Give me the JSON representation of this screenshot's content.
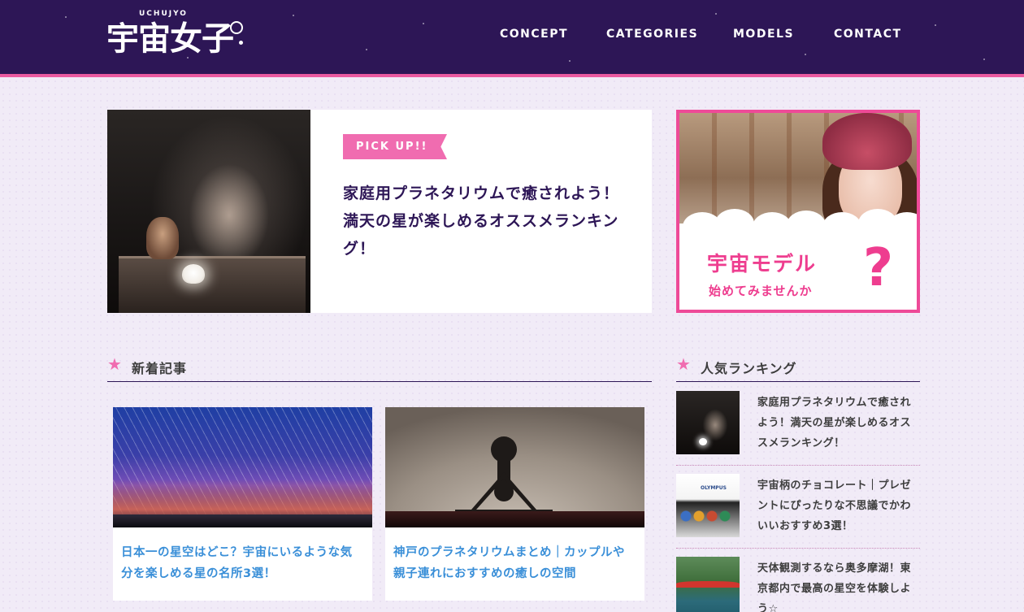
{
  "header": {
    "logo_small": "UCHUJYO",
    "logo_main": "宇宙女子",
    "nav": [
      {
        "label": "CONCEPT"
      },
      {
        "label": "CATEGORIES"
      },
      {
        "label": "MODELS"
      },
      {
        "label": "CONTACT"
      }
    ]
  },
  "pickup": {
    "badge": "PICK UP!!",
    "title": "家庭用プラネタリウムで癒されよう！満天の星が楽しめるオススメランキング！"
  },
  "model_banner": {
    "title": "宇宙モデル",
    "subtitle": "始めてみませんか",
    "mark": "?"
  },
  "new_articles": {
    "heading": "新着記事",
    "items": [
      {
        "title": "日本一の星空はどこ？宇宙にいるような気分を楽しめる星の名所3選！"
      },
      {
        "title": "神戸のプラネタリウムまとめ｜カップルや親子連れにおすすめの癒しの空間"
      }
    ]
  },
  "ranking": {
    "heading": "人気ランキング",
    "items": [
      {
        "title": "家庭用プラネタリウムで癒されよう！満天の星が楽しめるオススメランキング！"
      },
      {
        "title": "宇宙柄のチョコレート｜プレゼントにぴったりな不思議でかわいいおすすめ3選！",
        "thumb_brand": "OLYMPUS"
      },
      {
        "title": "天体観測するなら奥多摩湖！東京都内で最高の星空を体験しよう☆"
      }
    ]
  },
  "colors": {
    "header_bg": "#2d1656",
    "accent_pink": "#f06cb0",
    "link_blue": "#3a8fd8",
    "page_bg": "#f1ebf7"
  }
}
